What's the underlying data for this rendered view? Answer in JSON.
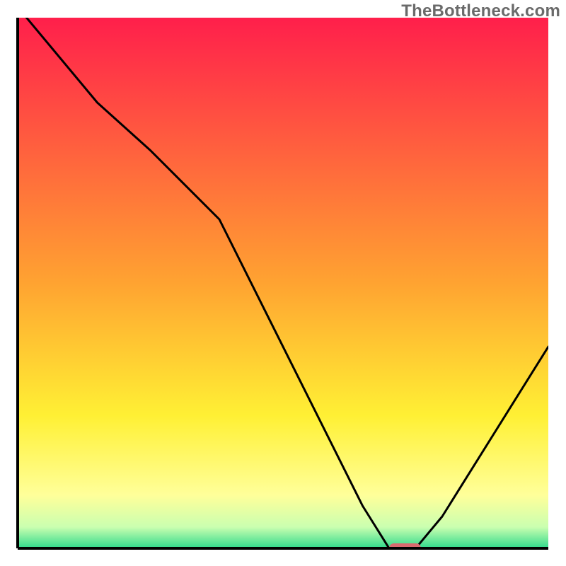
{
  "watermark": "TheBottleneck.com",
  "chart_data": {
    "type": "line",
    "title": "",
    "xlabel": "",
    "ylabel": "",
    "xlim": [
      0,
      100
    ],
    "ylim": [
      0,
      100
    ],
    "x": [
      0,
      5,
      15,
      25,
      38,
      65,
      70,
      75,
      80,
      100
    ],
    "values": [
      102,
      96,
      84,
      75,
      62,
      8,
      0,
      0,
      6,
      38
    ],
    "marker": {
      "x_start": 70,
      "x_end": 76,
      "y": 0,
      "color": "#d96a6f"
    },
    "background_gradient": [
      {
        "offset": 0.0,
        "color": "#ff1f4b"
      },
      {
        "offset": 0.5,
        "color": "#ffa331"
      },
      {
        "offset": 0.75,
        "color": "#fff034"
      },
      {
        "offset": 0.9,
        "color": "#ffff9a"
      },
      {
        "offset": 0.96,
        "color": "#caffb0"
      },
      {
        "offset": 1.0,
        "color": "#2fd98c"
      }
    ],
    "axis_visible": {
      "left": true,
      "bottom": true,
      "right": false,
      "top": false
    }
  }
}
